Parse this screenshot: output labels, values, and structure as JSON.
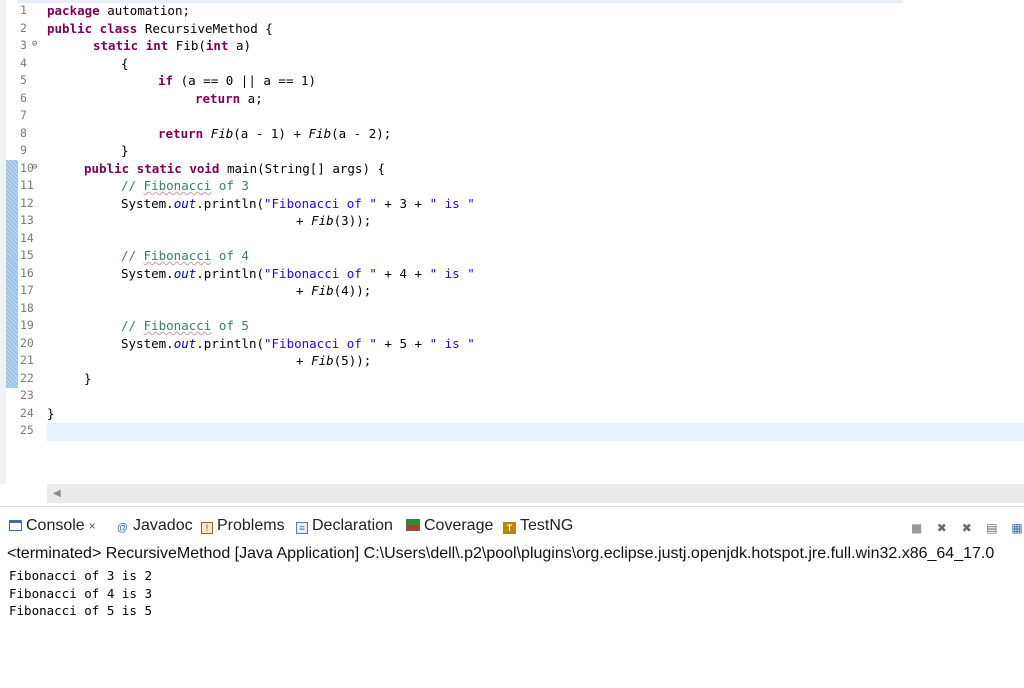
{
  "editor": {
    "line_numbers": [
      "1",
      "2",
      "3",
      "4",
      "5",
      "6",
      "7",
      "8",
      "9",
      "10",
      "11",
      "12",
      "13",
      "14",
      "15",
      "16",
      "17",
      "18",
      "19",
      "20",
      "21",
      "22",
      "23",
      "24",
      "25"
    ],
    "code": {
      "l1_kw": "package",
      "l1_rest": " automation;",
      "l2_kw": "public class",
      "l2_rest": " RecursiveMethod {",
      "l3_kw1": "static int",
      "l3_rest": " Fib(",
      "l3_kw2": "int",
      "l3_end": " a)",
      "l4": "{",
      "l5_kw": "if",
      "l5_rest": " (a == 0 || a == 1)",
      "l6_kw": "return",
      "l6_rest": " a;",
      "l8_kw": "return",
      "l8_a": " ",
      "l8_fn1": "Fib",
      "l8_b": "(a - 1) + ",
      "l8_fn2": "Fib",
      "l8_c": "(a - 2);",
      "l9": "}",
      "l10_kw": "public static void",
      "l10_rest": " main(String[] args) {",
      "l11_cm": "// ",
      "l11_w": "Fibonacci",
      "l11_end": " of 3",
      "l12_a": "System.",
      "l12_out": "out",
      "l12_b": ".println(",
      "l12_s1": "\"Fibonacci of \"",
      "l12_c": " + 3 + ",
      "l12_s2": "\" is \"",
      "l13_a": "+ ",
      "l13_fn": "Fib",
      "l13_b": "(3));",
      "l15_cm": "// ",
      "l15_w": "Fibonacci",
      "l15_end": " of 4",
      "l16_a": "System.",
      "l16_out": "out",
      "l16_b": ".println(",
      "l16_s1": "\"Fibonacci of \"",
      "l16_c": " + 4 + ",
      "l16_s2": "\" is \"",
      "l17_a": "+ ",
      "l17_fn": "Fib",
      "l17_b": "(4));",
      "l19_cm": "// ",
      "l19_w": "Fibonacci",
      "l19_end": " of 5",
      "l20_a": "System.",
      "l20_out": "out",
      "l20_b": ".println(",
      "l20_s1": "\"Fibonacci of \"",
      "l20_c": " + 5 + ",
      "l20_s2": "\" is \"",
      "l21_a": "+ ",
      "l21_fn": "Fib",
      "l21_b": "(5));",
      "l22": "}",
      "l24": "}"
    }
  },
  "panel": {
    "tabs": [
      {
        "label": "Console",
        "icon": "console-icon"
      },
      {
        "label": "Javadoc",
        "icon": "javadoc-icon"
      },
      {
        "label": "Problems",
        "icon": "problems-icon"
      },
      {
        "label": "Declaration",
        "icon": "declaration-icon"
      },
      {
        "label": "Coverage",
        "icon": "coverage-icon"
      },
      {
        "label": "TestNG",
        "icon": "testng-icon"
      }
    ],
    "close_glyph": "×",
    "terminated": "<terminated> RecursiveMethod [Java Application] C:\\Users\\dell\\.p2\\pool\\plugins\\org.eclipse.justj.openjdk.hotspot.jre.full.win32.x86_64_17.0",
    "output": [
      "Fibonacci of 3 is 2",
      "Fibonacci of 4 is 3",
      "Fibonacci of 5 is 5"
    ]
  }
}
